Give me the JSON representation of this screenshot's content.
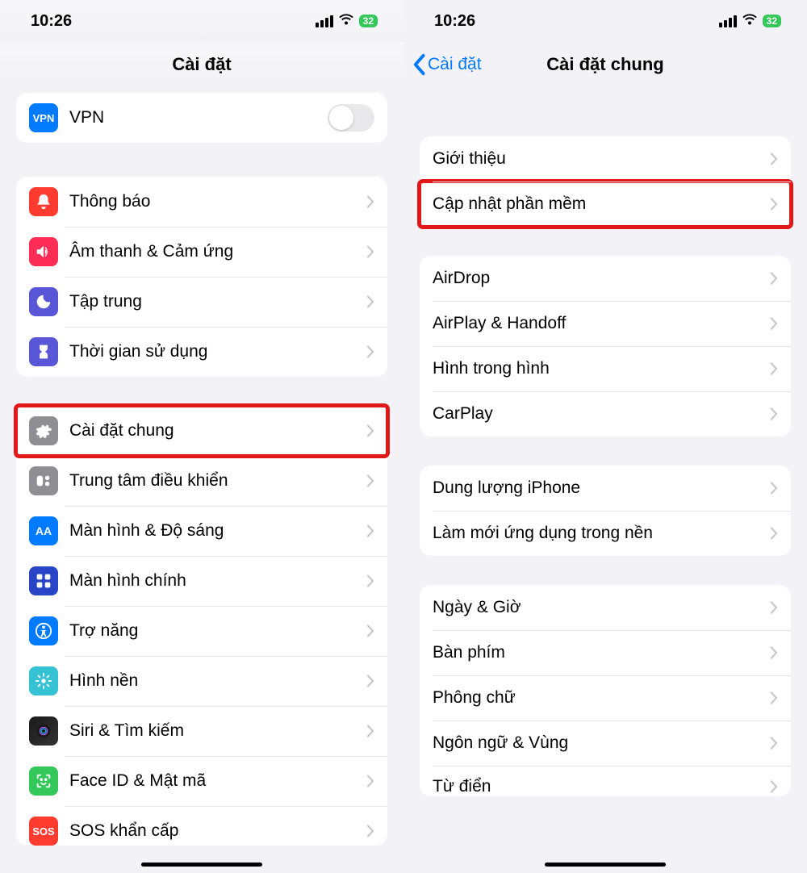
{
  "status": {
    "time": "10:26",
    "battery": "32"
  },
  "left": {
    "title": "Cài đặt",
    "groups": [
      {
        "rows": [
          {
            "icon": "vpn",
            "label": "VPN",
            "trailing": "toggle"
          }
        ]
      },
      {
        "rows": [
          {
            "icon": "noti",
            "label": "Thông báo"
          },
          {
            "icon": "sound",
            "label": "Âm thanh & Cảm ứng"
          },
          {
            "icon": "focus",
            "label": "Tập trung"
          },
          {
            "icon": "screentime",
            "label": "Thời gian sử dụng"
          }
        ]
      },
      {
        "rows": [
          {
            "icon": "general",
            "label": "Cài đặt chung",
            "highlight": true
          },
          {
            "icon": "control",
            "label": "Trung tâm điều khiển"
          },
          {
            "icon": "display",
            "label": "Màn hình & Độ sáng"
          },
          {
            "icon": "home",
            "label": "Màn hình chính"
          },
          {
            "icon": "access",
            "label": "Trợ năng"
          },
          {
            "icon": "wall",
            "label": "Hình nền"
          },
          {
            "icon": "siri",
            "label": "Siri & Tìm kiếm"
          },
          {
            "icon": "face",
            "label": "Face ID & Mật mã"
          },
          {
            "icon": "sos",
            "label": "SOS khẩn cấp",
            "partial": true
          }
        ]
      }
    ]
  },
  "right": {
    "back": "Cài đặt",
    "title": "Cài đặt chung",
    "groups": [
      {
        "rows": [
          {
            "label": "Giới thiệu"
          },
          {
            "label": "Cập nhật phần mềm",
            "highlight": true
          }
        ]
      },
      {
        "rows": [
          {
            "label": "AirDrop"
          },
          {
            "label": "AirPlay & Handoff"
          },
          {
            "label": "Hình trong hình"
          },
          {
            "label": "CarPlay"
          }
        ]
      },
      {
        "rows": [
          {
            "label": "Dung lượng iPhone"
          },
          {
            "label": "Làm mới ứng dụng trong nền"
          }
        ]
      },
      {
        "rows": [
          {
            "label": "Ngày & Giờ"
          },
          {
            "label": "Bàn phím"
          },
          {
            "label": "Phông chữ"
          },
          {
            "label": "Ngôn ngữ & Vùng"
          },
          {
            "label": "Từ điển",
            "partial": true
          }
        ]
      }
    ]
  }
}
